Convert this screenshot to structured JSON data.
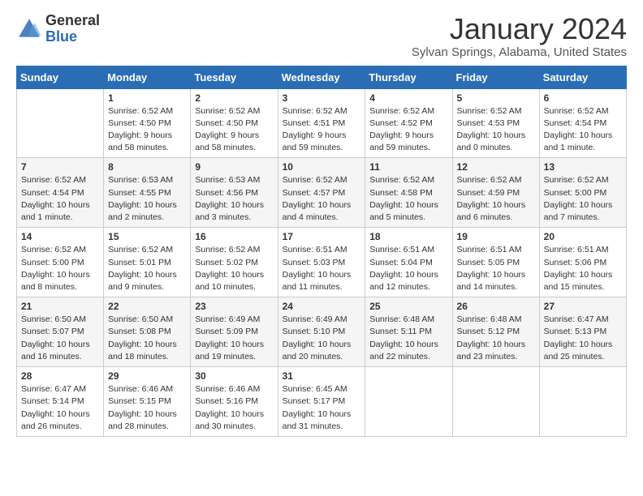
{
  "header": {
    "logo_general": "General",
    "logo_blue": "Blue",
    "month_title": "January 2024",
    "location": "Sylvan Springs, Alabama, United States"
  },
  "weekdays": [
    "Sunday",
    "Monday",
    "Tuesday",
    "Wednesday",
    "Thursday",
    "Friday",
    "Saturday"
  ],
  "weeks": [
    [
      {
        "day": "",
        "info": ""
      },
      {
        "day": "1",
        "info": "Sunrise: 6:52 AM\nSunset: 4:50 PM\nDaylight: 9 hours\nand 58 minutes."
      },
      {
        "day": "2",
        "info": "Sunrise: 6:52 AM\nSunset: 4:50 PM\nDaylight: 9 hours\nand 58 minutes."
      },
      {
        "day": "3",
        "info": "Sunrise: 6:52 AM\nSunset: 4:51 PM\nDaylight: 9 hours\nand 59 minutes."
      },
      {
        "day": "4",
        "info": "Sunrise: 6:52 AM\nSunset: 4:52 PM\nDaylight: 9 hours\nand 59 minutes."
      },
      {
        "day": "5",
        "info": "Sunrise: 6:52 AM\nSunset: 4:53 PM\nDaylight: 10 hours\nand 0 minutes."
      },
      {
        "day": "6",
        "info": "Sunrise: 6:52 AM\nSunset: 4:54 PM\nDaylight: 10 hours\nand 1 minute."
      }
    ],
    [
      {
        "day": "7",
        "info": "Sunrise: 6:52 AM\nSunset: 4:54 PM\nDaylight: 10 hours\nand 1 minute."
      },
      {
        "day": "8",
        "info": "Sunrise: 6:53 AM\nSunset: 4:55 PM\nDaylight: 10 hours\nand 2 minutes."
      },
      {
        "day": "9",
        "info": "Sunrise: 6:53 AM\nSunset: 4:56 PM\nDaylight: 10 hours\nand 3 minutes."
      },
      {
        "day": "10",
        "info": "Sunrise: 6:52 AM\nSunset: 4:57 PM\nDaylight: 10 hours\nand 4 minutes."
      },
      {
        "day": "11",
        "info": "Sunrise: 6:52 AM\nSunset: 4:58 PM\nDaylight: 10 hours\nand 5 minutes."
      },
      {
        "day": "12",
        "info": "Sunrise: 6:52 AM\nSunset: 4:59 PM\nDaylight: 10 hours\nand 6 minutes."
      },
      {
        "day": "13",
        "info": "Sunrise: 6:52 AM\nSunset: 5:00 PM\nDaylight: 10 hours\nand 7 minutes."
      }
    ],
    [
      {
        "day": "14",
        "info": "Sunrise: 6:52 AM\nSunset: 5:00 PM\nDaylight: 10 hours\nand 8 minutes."
      },
      {
        "day": "15",
        "info": "Sunrise: 6:52 AM\nSunset: 5:01 PM\nDaylight: 10 hours\nand 9 minutes."
      },
      {
        "day": "16",
        "info": "Sunrise: 6:52 AM\nSunset: 5:02 PM\nDaylight: 10 hours\nand 10 minutes."
      },
      {
        "day": "17",
        "info": "Sunrise: 6:51 AM\nSunset: 5:03 PM\nDaylight: 10 hours\nand 11 minutes."
      },
      {
        "day": "18",
        "info": "Sunrise: 6:51 AM\nSunset: 5:04 PM\nDaylight: 10 hours\nand 12 minutes."
      },
      {
        "day": "19",
        "info": "Sunrise: 6:51 AM\nSunset: 5:05 PM\nDaylight: 10 hours\nand 14 minutes."
      },
      {
        "day": "20",
        "info": "Sunrise: 6:51 AM\nSunset: 5:06 PM\nDaylight: 10 hours\nand 15 minutes."
      }
    ],
    [
      {
        "day": "21",
        "info": "Sunrise: 6:50 AM\nSunset: 5:07 PM\nDaylight: 10 hours\nand 16 minutes."
      },
      {
        "day": "22",
        "info": "Sunrise: 6:50 AM\nSunset: 5:08 PM\nDaylight: 10 hours\nand 18 minutes."
      },
      {
        "day": "23",
        "info": "Sunrise: 6:49 AM\nSunset: 5:09 PM\nDaylight: 10 hours\nand 19 minutes."
      },
      {
        "day": "24",
        "info": "Sunrise: 6:49 AM\nSunset: 5:10 PM\nDaylight: 10 hours\nand 20 minutes."
      },
      {
        "day": "25",
        "info": "Sunrise: 6:48 AM\nSunset: 5:11 PM\nDaylight: 10 hours\nand 22 minutes."
      },
      {
        "day": "26",
        "info": "Sunrise: 6:48 AM\nSunset: 5:12 PM\nDaylight: 10 hours\nand 23 minutes."
      },
      {
        "day": "27",
        "info": "Sunrise: 6:47 AM\nSunset: 5:13 PM\nDaylight: 10 hours\nand 25 minutes."
      }
    ],
    [
      {
        "day": "28",
        "info": "Sunrise: 6:47 AM\nSunset: 5:14 PM\nDaylight: 10 hours\nand 26 minutes."
      },
      {
        "day": "29",
        "info": "Sunrise: 6:46 AM\nSunset: 5:15 PM\nDaylight: 10 hours\nand 28 minutes."
      },
      {
        "day": "30",
        "info": "Sunrise: 6:46 AM\nSunset: 5:16 PM\nDaylight: 10 hours\nand 30 minutes."
      },
      {
        "day": "31",
        "info": "Sunrise: 6:45 AM\nSunset: 5:17 PM\nDaylight: 10 hours\nand 31 minutes."
      },
      {
        "day": "",
        "info": ""
      },
      {
        "day": "",
        "info": ""
      },
      {
        "day": "",
        "info": ""
      }
    ]
  ]
}
